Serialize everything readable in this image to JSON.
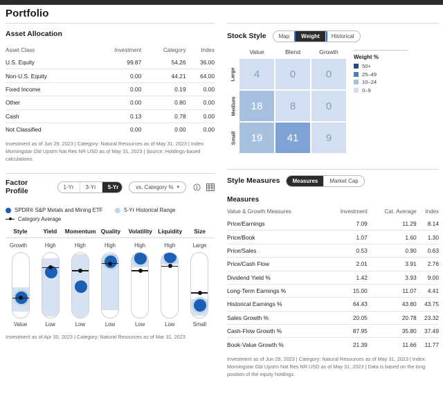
{
  "page": {
    "title": "Portfolio"
  },
  "asset_allocation": {
    "title": "Asset Allocation",
    "columns": [
      "Asset Class",
      "Investment",
      "Category",
      "Index"
    ],
    "rows": [
      {
        "label": "U.S. Equity",
        "investment": "99.87",
        "category": "54.26",
        "index": "36.00"
      },
      {
        "label": "Non-U.S. Equity",
        "investment": "0.00",
        "category": "44.21",
        "index": "64.00"
      },
      {
        "label": "Fixed Income",
        "investment": "0.00",
        "category": "0.19",
        "index": "0.00"
      },
      {
        "label": "Other",
        "investment": "0.00",
        "category": "0.80",
        "index": "0.00"
      },
      {
        "label": "Cash",
        "investment": "0.13",
        "category": "0.78",
        "index": "0.00"
      },
      {
        "label": "Not Classified",
        "investment": "0.00",
        "category": "0.00",
        "index": "0.00"
      }
    ],
    "footnote": "Investment as of Jun 29, 2023 | Category: Natural Resources as of May 31, 2023 | Index: Morningstar Gbl Upstm Nat Res NR USD as of May 31, 2023 | Source: Holdings-based calculations."
  },
  "stock_style": {
    "title": "Stock Style",
    "tabs": [
      {
        "label": "Map",
        "active": false
      },
      {
        "label": "Weight",
        "active": true
      },
      {
        "label": "Historical",
        "active": false
      }
    ],
    "column_headers": [
      "Value",
      "Blend",
      "Growth"
    ],
    "row_headers": [
      "Large",
      "Medium",
      "Small"
    ],
    "grid": [
      [
        {
          "value": "4",
          "tier": "w0"
        },
        {
          "value": "0",
          "tier": "w0"
        },
        {
          "value": "0",
          "tier": "w0"
        }
      ],
      [
        {
          "value": "18",
          "tier": "w10"
        },
        {
          "value": "8",
          "tier": "w0"
        },
        {
          "value": "0",
          "tier": "w0"
        }
      ],
      [
        {
          "value": "19",
          "tier": "w10"
        },
        {
          "value": "41",
          "tier": "w25"
        },
        {
          "value": "9",
          "tier": "w0"
        }
      ]
    ],
    "legend": {
      "title": "Weight %",
      "items": [
        {
          "label": "50+",
          "color": "#26478d"
        },
        {
          "label": "25–49",
          "color": "#4a7cc0"
        },
        {
          "label": "10–24",
          "color": "#a8c0e0"
        },
        {
          "label": "0–9",
          "color": "#d3dff0"
        }
      ]
    }
  },
  "factor_profile": {
    "title": "Factor Profile",
    "period_tabs": [
      {
        "label": "1-Yr",
        "active": false
      },
      {
        "label": "3-Yr",
        "active": false
      },
      {
        "label": "5-Yr",
        "active": true
      }
    ],
    "dropdown": {
      "label": "vs. Category %",
      "caret": "chevron-down-icon"
    },
    "icons": [
      "info-icon",
      "table-icon"
    ],
    "legend": [
      {
        "label": "SPDR® S&P Metals and Mining ETF",
        "marker": "blue-dot"
      },
      {
        "label": "5-Yr Historical Range",
        "marker": "light-dot"
      },
      {
        "label": "Category Average",
        "marker": "line-dot"
      }
    ],
    "factors": [
      {
        "name": "Style",
        "top": "Growth",
        "bottom": "Value",
        "dot_pct": 68,
        "range_top_pct": 52,
        "range_bottom_pct": 88,
        "avg_pct": 68,
        "halo": true
      },
      {
        "name": "Yield",
        "top": "High",
        "bottom": "Low",
        "dot_pct": 29,
        "range_top_pct": 8,
        "range_bottom_pct": 96,
        "avg_pct": 22,
        "halo": false
      },
      {
        "name": "Momentum",
        "top": "High",
        "bottom": "Low",
        "dot_pct": 51,
        "range_top_pct": 2,
        "range_bottom_pct": 98,
        "avg_pct": 27,
        "halo": false
      },
      {
        "name": "Quality",
        "top": "High",
        "bottom": "Low",
        "dot_pct": 13,
        "range_top_pct": 2,
        "range_bottom_pct": 86,
        "avg_pct": 16,
        "halo": true
      },
      {
        "name": "Volatility",
        "top": "High",
        "bottom": "Low",
        "dot_pct": 8,
        "range_top_pct": 2,
        "range_bottom_pct": 22,
        "avg_pct": 27,
        "halo": true
      },
      {
        "name": "Liquidity",
        "top": "High",
        "bottom": "Low",
        "dot_pct": 6,
        "range_top_pct": 2,
        "range_bottom_pct": 18,
        "avg_pct": 20,
        "halo": true
      },
      {
        "name": "Size",
        "top": "Large",
        "bottom": "Small",
        "dot_pct": 79,
        "range_top_pct": 70,
        "range_bottom_pct": 95,
        "avg_pct": 60,
        "halo": true
      }
    ],
    "footnote": "Investment as of Apr 30, 2023 | Category: Natural Resources as of Mar 31, 2023"
  },
  "style_measures": {
    "title": "Style Measures",
    "tabs": [
      {
        "label": "Measures",
        "active": true
      },
      {
        "label": "Market Cap",
        "active": false
      }
    ],
    "section_title": "Measures",
    "columns": [
      "Value & Growth Measures",
      "Investment",
      "Cat. Average",
      "Index"
    ],
    "rows": [
      {
        "label": "Price/Earnings",
        "investment": "7.09",
        "cat_average": "11.29",
        "index": "8.14"
      },
      {
        "label": "Price/Book",
        "investment": "1.07",
        "cat_average": "1.60",
        "index": "1.30"
      },
      {
        "label": "Price/Sales",
        "investment": "0.53",
        "cat_average": "0.90",
        "index": "0.63"
      },
      {
        "label": "Price/Cash Flow",
        "investment": "2.01",
        "cat_average": "3.91",
        "index": "2.76"
      },
      {
        "label": "Dividend Yield %",
        "investment": "1.42",
        "cat_average": "3.93",
        "index": "9.00"
      },
      {
        "label": "Long-Term Earnings %",
        "investment": "15.00",
        "cat_average": "11.07",
        "index": "4.41"
      },
      {
        "label": "Historical Earnings %",
        "investment": "64.43",
        "cat_average": "43.80",
        "index": "43.75"
      },
      {
        "label": "Sales Growth %",
        "investment": "20.05",
        "cat_average": "20.78",
        "index": "23.32"
      },
      {
        "label": "Cash-Flow Growth %",
        "investment": "87.95",
        "cat_average": "35.80",
        "index": "37.49"
      },
      {
        "label": "Book-Value Growth %",
        "investment": "21.39",
        "cat_average": "11.66",
        "index": "11.77"
      }
    ],
    "footnote": "Investment as of Jun 29, 2023 | Category: Natural Resources as of May 31, 2023 | Index: Morningstar Gbl Upstm Nat Res NR USD as of May 31, 2023 | Data is based on the long position of the equity holdings."
  }
}
